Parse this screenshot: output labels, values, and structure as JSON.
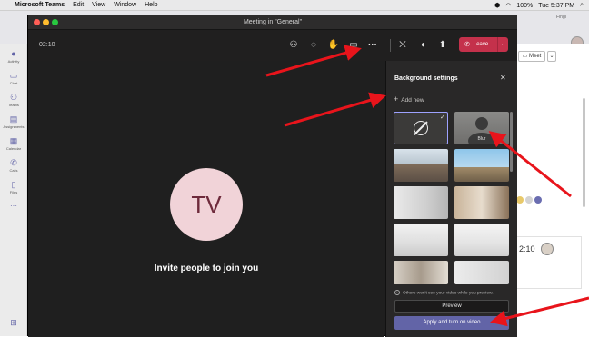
{
  "menubar": {
    "app": "Microsoft Teams",
    "items": [
      "Edit",
      "View",
      "Window",
      "Help"
    ],
    "battery": "100%",
    "clock": "Tue 5:37 PM"
  },
  "background_window": {
    "rail": [
      {
        "label": "Activity",
        "icon": "bell-icon"
      },
      {
        "label": "Chat",
        "icon": "chat-icon"
      },
      {
        "label": "Teams",
        "icon": "teams-icon"
      },
      {
        "label": "Assignments",
        "icon": "assignments-icon"
      },
      {
        "label": "Calendar",
        "icon": "calendar-icon"
      },
      {
        "label": "Calls",
        "icon": "phone-icon"
      },
      {
        "label": "Files",
        "icon": "file-icon"
      },
      {
        "label": "···",
        "icon": "more-icon"
      }
    ],
    "meet_button": "Meet",
    "card_time": "2:10",
    "tab_hint": "Fingi"
  },
  "meeting": {
    "title": "Meeting in \"General\"",
    "timer": "02:10",
    "leave_label": "Leave",
    "avatar_initials": "TV",
    "invite_text": "Invite people to join you",
    "colors": {
      "leave": "#c4314b",
      "accent": "#6264a7",
      "avatar_bg": "#f1d3d8"
    }
  },
  "background_settings": {
    "title": "Background settings",
    "add_new": "Add new",
    "blur_label": "Blur",
    "note": "Others won't see your video while you preview.",
    "preview_button": "Preview",
    "apply_button": "Apply and turn on video"
  }
}
